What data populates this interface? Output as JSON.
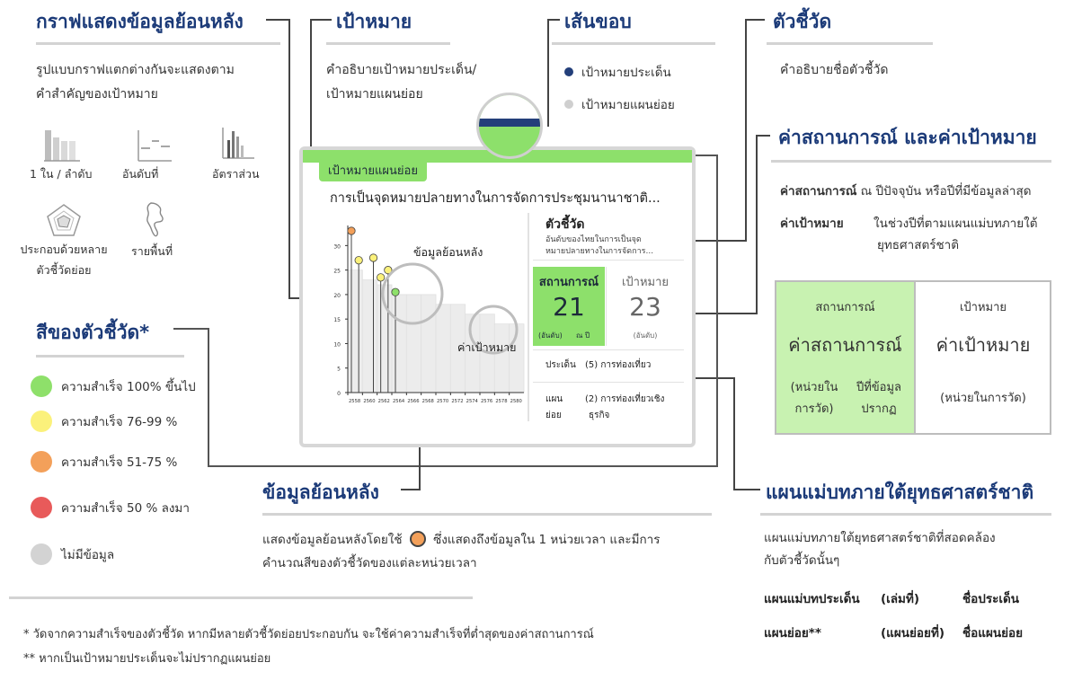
{
  "sections": {
    "history_graph": {
      "title": "กราฟแสดงข้อมูลย้อนหลัง",
      "desc_1": "รูปแบบกราฟแตกต่างกันจะแสดงตาม",
      "desc_2": "คำสำคัญของเป้าหมาย",
      "icons": [
        {
          "name": "bar-chart-icon",
          "label": "1 ใน / ลำดับ"
        },
        {
          "name": "rank-chart-icon",
          "label": "อันดับที่"
        },
        {
          "name": "ratio-chart-icon",
          "label": "อัตราส่วน"
        },
        {
          "name": "radar-chart-icon",
          "label_1": "ประกอบด้วยหลาย",
          "label_2": "ตัวชี้วัดย่อย"
        },
        {
          "name": "map-icon",
          "label": "รายพื้นที่"
        }
      ]
    },
    "goal": {
      "title": "เป้าหมาย",
      "desc_1": "คำอธิบายเป้าหมายประเด็น/",
      "desc_2": "เป้าหมายแผนย่อย"
    },
    "border": {
      "title": "เส้นขอบ",
      "items": [
        {
          "label": "เป้าหมายประเด็น",
          "color": "#233f7a"
        },
        {
          "label": "เป้าหมายแผนย่อย",
          "color": "#cfcfcf"
        }
      ]
    },
    "indicator": {
      "title": "ตัวชี้วัด",
      "desc": "คำอธิบายชื่อตัวชี้วัด"
    },
    "status_target": {
      "title": "ค่าสถานการณ์ และค่าเป้าหมาย",
      "row1_bold": "ค่าสถานการณ์",
      "row1_rest": " ณ ปีปัจจุบัน หรือปีที่มีข้อมูลล่าสุด",
      "row2_bold": "ค่าเป้าหมาย",
      "row2_rest_1": "ในช่วงปีที่ตามแผนแม่บทภายใต้",
      "row2_rest_2": "ยุทธศาสตร์ชาติ",
      "table": {
        "left_head": "สถานการณ์",
        "left_value": "ค่าสถานการณ์",
        "left_unit_1": "(หน่วยใน",
        "left_unit_2": "การวัด)",
        "left_year_1": "ปีที่ข้อมูล",
        "left_year_2": "ปรากฏ",
        "right_head": "เป้าหมาย",
        "right_value": "ค่าเป้าหมาย",
        "right_unit": "(หน่วยในการวัด)"
      }
    },
    "indicator_color": {
      "title": "สีของตัวชี้วัด*",
      "items": [
        {
          "label": "ความสำเร็จ 100% ขึ้นไป",
          "color": "#8ee06a"
        },
        {
          "label": "ความสำเร็จ 76-99 %",
          "color": "#fbf17b"
        },
        {
          "label": "ความสำเร็จ 51-75 %",
          "color": "#f3a05a"
        },
        {
          "label": "ความสำเร็จ 50 % ลงมา",
          "color": "#e85a5a"
        },
        {
          "label": "ไม่มีข้อมูล",
          "color": "#d3d3d3"
        }
      ]
    },
    "history_data": {
      "title": "ข้อมูลย้อนหลัง",
      "desc_1a": "แสดงข้อมูลย้อนหลังโดยใช้",
      "desc_1b": "ซึ่งแสดงถึงข้อมูลใน 1 หน่วยเวลา และมีการ",
      "desc_2": "คำนวณสีของตัวชี้วัดของแต่ละหน่วยเวลา"
    },
    "master_plan": {
      "title": "แผนแม่บทภายใต้ยุทธศาสตร์ชาติ",
      "desc_1": "แผนแม่บทภายใต้ยุทธศาสตร์ชาติที่สอดคล้อง",
      "desc_2": "กับตัวชี้วัดนั้นๆ",
      "row1": [
        "แผนแม่บทประเด็น",
        "(เล่มที่)",
        "ชื่อประเด็น"
      ],
      "row2": [
        "แผนย่อย**",
        "(แผนย่อยที่)",
        "ชื่อแผนย่อย"
      ]
    }
  },
  "card": {
    "badge": "เป้าหมายแผนย่อย",
    "goal_text": "การเป็นจุดหมายปลายทางในการจัดการประชุมนานาชาติ...",
    "indicator_title": "ตัวชี้วัด",
    "indicator_desc_1": "อันดับของไทยในการเป็นจุด",
    "indicator_desc_2": "หมายปลายทางในการจัดการ...",
    "status_label": "สถานการณ์",
    "status_value": "21",
    "status_unit": "(อันดับ)",
    "status_year": "ณ ปี",
    "target_label": "เป้าหมาย",
    "target_value": "23",
    "target_unit": "(อันดับ)",
    "issue_label": "ประเด็น",
    "issue_value": "(5) การท่องเที่ยว",
    "plan_label_1": "แผน",
    "plan_label_2": "ย่อย",
    "plan_value_1": "(2) การท่องเที่ยวเชิง",
    "plan_value_2": "ธุรกิจ",
    "callout_history": "ข้อมูลย้อนหลัง",
    "callout_target": "ค่าเป้าหมาย"
  },
  "chart_data": {
    "type": "bar",
    "yticks": [
      "0",
      "5",
      "10",
      "15",
      "20",
      "25",
      "30"
    ],
    "ylim": [
      0,
      33
    ],
    "categories": [
      "2558",
      "2560",
      "2562",
      "2564",
      "2566",
      "2568",
      "2570",
      "2572",
      "2574",
      "2576",
      "2578",
      "2580"
    ],
    "bar_values": [
      25,
      23,
      22,
      20,
      20,
      20,
      18,
      18,
      16,
      16,
      14,
      14
    ],
    "points": [
      {
        "x": "2558",
        "y": 33,
        "color": "#f3a05a"
      },
      {
        "x": "2559",
        "y": 27,
        "color": "#fbf17b"
      },
      {
        "x": "2561",
        "y": 27.5,
        "color": "#fbf17b"
      },
      {
        "x": "2562",
        "y": 23.5,
        "color": "#fbf17b"
      },
      {
        "x": "2563",
        "y": 25,
        "color": "#fbf17b"
      },
      {
        "x": "2564",
        "y": 20.5,
        "color": "#8ee06a"
      }
    ]
  },
  "footnotes": {
    "note1": "*  วัดจากความสำเร็จของตัวชี้วัด หากมีหลายตัวชี้วัดย่อยประกอบกัน จะใช้ค่าความสำเร็จที่ต่ำสุดของค่าสถานการณ์",
    "note2": "** หากเป็นเป้าหมายประเด็นจะไม่ปรากฏแผนย่อย"
  }
}
